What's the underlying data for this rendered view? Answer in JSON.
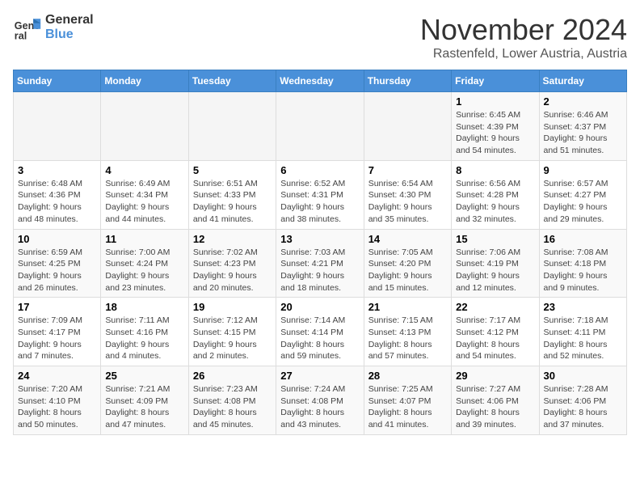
{
  "logo": {
    "line1": "General",
    "line2": "Blue"
  },
  "title": "November 2024",
  "subtitle": "Rastenfeld, Lower Austria, Austria",
  "weekdays": [
    "Sunday",
    "Monday",
    "Tuesday",
    "Wednesday",
    "Thursday",
    "Friday",
    "Saturday"
  ],
  "weeks": [
    [
      {
        "day": "",
        "info": ""
      },
      {
        "day": "",
        "info": ""
      },
      {
        "day": "",
        "info": ""
      },
      {
        "day": "",
        "info": ""
      },
      {
        "day": "",
        "info": ""
      },
      {
        "day": "1",
        "info": "Sunrise: 6:45 AM\nSunset: 4:39 PM\nDaylight: 9 hours and 54 minutes."
      },
      {
        "day": "2",
        "info": "Sunrise: 6:46 AM\nSunset: 4:37 PM\nDaylight: 9 hours and 51 minutes."
      }
    ],
    [
      {
        "day": "3",
        "info": "Sunrise: 6:48 AM\nSunset: 4:36 PM\nDaylight: 9 hours and 48 minutes."
      },
      {
        "day": "4",
        "info": "Sunrise: 6:49 AM\nSunset: 4:34 PM\nDaylight: 9 hours and 44 minutes."
      },
      {
        "day": "5",
        "info": "Sunrise: 6:51 AM\nSunset: 4:33 PM\nDaylight: 9 hours and 41 minutes."
      },
      {
        "day": "6",
        "info": "Sunrise: 6:52 AM\nSunset: 4:31 PM\nDaylight: 9 hours and 38 minutes."
      },
      {
        "day": "7",
        "info": "Sunrise: 6:54 AM\nSunset: 4:30 PM\nDaylight: 9 hours and 35 minutes."
      },
      {
        "day": "8",
        "info": "Sunrise: 6:56 AM\nSunset: 4:28 PM\nDaylight: 9 hours and 32 minutes."
      },
      {
        "day": "9",
        "info": "Sunrise: 6:57 AM\nSunset: 4:27 PM\nDaylight: 9 hours and 29 minutes."
      }
    ],
    [
      {
        "day": "10",
        "info": "Sunrise: 6:59 AM\nSunset: 4:25 PM\nDaylight: 9 hours and 26 minutes."
      },
      {
        "day": "11",
        "info": "Sunrise: 7:00 AM\nSunset: 4:24 PM\nDaylight: 9 hours and 23 minutes."
      },
      {
        "day": "12",
        "info": "Sunrise: 7:02 AM\nSunset: 4:23 PM\nDaylight: 9 hours and 20 minutes."
      },
      {
        "day": "13",
        "info": "Sunrise: 7:03 AM\nSunset: 4:21 PM\nDaylight: 9 hours and 18 minutes."
      },
      {
        "day": "14",
        "info": "Sunrise: 7:05 AM\nSunset: 4:20 PM\nDaylight: 9 hours and 15 minutes."
      },
      {
        "day": "15",
        "info": "Sunrise: 7:06 AM\nSunset: 4:19 PM\nDaylight: 9 hours and 12 minutes."
      },
      {
        "day": "16",
        "info": "Sunrise: 7:08 AM\nSunset: 4:18 PM\nDaylight: 9 hours and 9 minutes."
      }
    ],
    [
      {
        "day": "17",
        "info": "Sunrise: 7:09 AM\nSunset: 4:17 PM\nDaylight: 9 hours and 7 minutes."
      },
      {
        "day": "18",
        "info": "Sunrise: 7:11 AM\nSunset: 4:16 PM\nDaylight: 9 hours and 4 minutes."
      },
      {
        "day": "19",
        "info": "Sunrise: 7:12 AM\nSunset: 4:15 PM\nDaylight: 9 hours and 2 minutes."
      },
      {
        "day": "20",
        "info": "Sunrise: 7:14 AM\nSunset: 4:14 PM\nDaylight: 8 hours and 59 minutes."
      },
      {
        "day": "21",
        "info": "Sunrise: 7:15 AM\nSunset: 4:13 PM\nDaylight: 8 hours and 57 minutes."
      },
      {
        "day": "22",
        "info": "Sunrise: 7:17 AM\nSunset: 4:12 PM\nDaylight: 8 hours and 54 minutes."
      },
      {
        "day": "23",
        "info": "Sunrise: 7:18 AM\nSunset: 4:11 PM\nDaylight: 8 hours and 52 minutes."
      }
    ],
    [
      {
        "day": "24",
        "info": "Sunrise: 7:20 AM\nSunset: 4:10 PM\nDaylight: 8 hours and 50 minutes."
      },
      {
        "day": "25",
        "info": "Sunrise: 7:21 AM\nSunset: 4:09 PM\nDaylight: 8 hours and 47 minutes."
      },
      {
        "day": "26",
        "info": "Sunrise: 7:23 AM\nSunset: 4:08 PM\nDaylight: 8 hours and 45 minutes."
      },
      {
        "day": "27",
        "info": "Sunrise: 7:24 AM\nSunset: 4:08 PM\nDaylight: 8 hours and 43 minutes."
      },
      {
        "day": "28",
        "info": "Sunrise: 7:25 AM\nSunset: 4:07 PM\nDaylight: 8 hours and 41 minutes."
      },
      {
        "day": "29",
        "info": "Sunrise: 7:27 AM\nSunset: 4:06 PM\nDaylight: 8 hours and 39 minutes."
      },
      {
        "day": "30",
        "info": "Sunrise: 7:28 AM\nSunset: 4:06 PM\nDaylight: 8 hours and 37 minutes."
      }
    ]
  ]
}
